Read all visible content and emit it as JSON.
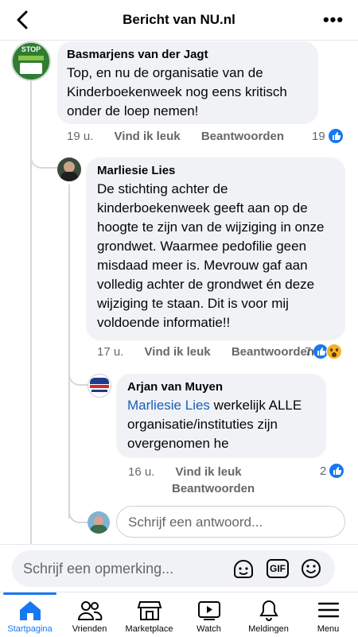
{
  "header": {
    "title": "Bericht van NU.nl"
  },
  "comments": [
    {
      "author": "Basmarjens van der Jagt",
      "text": "Top, en nu de organisatie van de Kinderboekenweek nog eens kritisch onder de loep nemen!",
      "time": "19 u.",
      "like_label": "Vind ik leuk",
      "reply_label": "Beantwoorden",
      "reactions": "19",
      "avatar_text": "STOP"
    },
    {
      "author": "Marliesie Lies",
      "text": "De stichting achter de kinderboekenweek geeft aan op de hoogte te zijn van de wijziging in onze grondwet. Waarmee pedofilie geen misdaad meer is. Mevrouw gaf aan volledig achter de grondwet én deze wijziging te staan. Dit is voor mij voldoende informatie!!",
      "time": "17 u.",
      "like_label": "Vind ik leuk",
      "reply_label": "Beantwoorden",
      "reactions": "7"
    },
    {
      "author": "Arjan van Muyen",
      "mention": "Marliesie Lies",
      "text": " werkelijk ALLE organisatie/instituties zijn overgenomen he",
      "time": "16 u.",
      "like_label": "Vind ik leuk",
      "reply_label": "Beantwoorden",
      "reactions": "2"
    }
  ],
  "reply_placeholder": "Schrijf een antwoord...",
  "comment_placeholder": "Schrijf een opmerking...",
  "gif_label": "GIF",
  "tabs": [
    {
      "label": "Startpagina",
      "icon": "home-icon",
      "active": true
    },
    {
      "label": "Vrienden",
      "icon": "friends-icon"
    },
    {
      "label": "Marketplace",
      "icon": "marketplace-icon"
    },
    {
      "label": "Watch",
      "icon": "watch-icon"
    },
    {
      "label": "Meldingen",
      "icon": "bell-icon"
    },
    {
      "label": "Menu",
      "icon": "menu-icon"
    }
  ],
  "colors": {
    "accent": "#1877f2",
    "bubble": "#f0f2f5",
    "muted": "#65676b"
  }
}
